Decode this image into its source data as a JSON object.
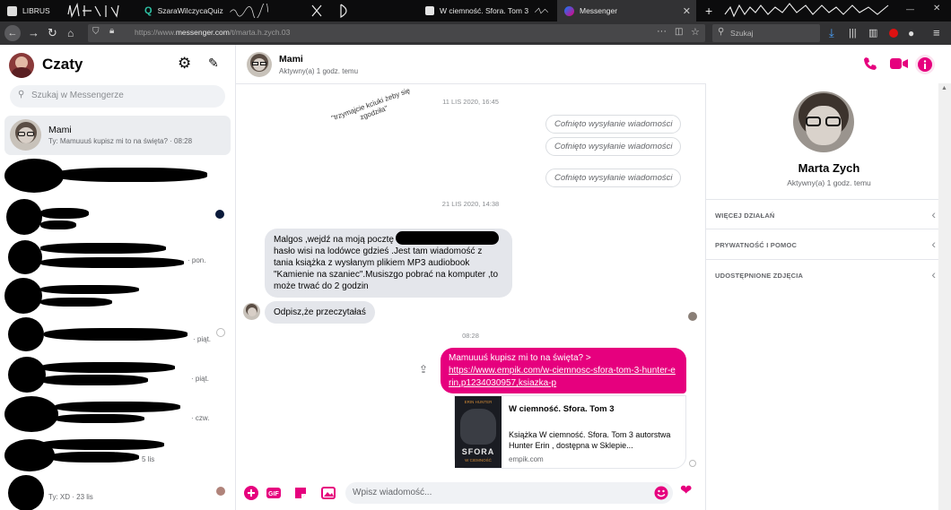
{
  "browser": {
    "tabs": [
      {
        "label": "LIBRUS"
      },
      {
        "label": ""
      },
      {
        "label": "SzaraWilczycaQuiz"
      },
      {
        "label": ""
      },
      {
        "label": "W ciemność. Sfora. Tom 3"
      },
      {
        "label": "Messenger"
      }
    ],
    "url_prefix": "https://www.",
    "url_domain": "messenger.com",
    "url_path": "/t/marta.h.zych.03",
    "search_placeholder": "Szukaj"
  },
  "sidebar": {
    "title": "Czaty",
    "search_placeholder": "Szukaj w Messengerze",
    "selected": {
      "name": "Mami",
      "preview": "Ty: Mamuuuś kupisz mi to na święta? · 08:28"
    },
    "previews": [
      {
        "text": "· pon."
      },
      {
        "text": "· piąt."
      },
      {
        "text": "· piąt."
      },
      {
        "text": "· czw."
      },
      {
        "text": "5 lis"
      },
      {
        "text": "Ty: XD · 23 lis"
      }
    ]
  },
  "conversation": {
    "name": "Mami",
    "status": "Aktywny(a) 1 godz. temu",
    "annotation": "\"trzymajcie kciuki żeby się zgodziła\"",
    "stamp1": "11 LIS 2020, 16:45",
    "unsent_label": "Cofnięto wysyłanie wiadomości",
    "stamp2": "21 LIS 2020, 14:38",
    "incoming1": "Malgos ,wejdź na moją pocztę",
    "incoming1_rest": "hasło wisi na lodówce gdzieś .Jest tam wiadomość z tania książka z wysłanym plikiem MP3  audiobook \"Kamienie na szaniec\".Musiszgo pobrać na komputer ,to może trwać do 2 godzin",
    "incoming2": "Odpisz,że przeczytałaś",
    "stamp3": "08:28",
    "outgoing_text": "Mamuuuś kupisz mi to na święta? >",
    "outgoing_link": "https://www.empik.com/w-ciemnosc-sfora-tom-3-hunter-erin,p1234030957,ksiazka-p",
    "card": {
      "title": "W ciemność. Sfora. Tom 3",
      "description": "Książka W ciemność. Sfora. Tom 3 autorstwa Hunter Erin , dostępna w Sklepie...",
      "domain": "empik.com",
      "book_author": "ERIN HUNTER",
      "book_title": "SFORA",
      "book_subtitle": "W CIEMNOŚĆ"
    },
    "composer_placeholder": "Wpisz wiadomość..."
  },
  "info_panel": {
    "name": "Marta Zych",
    "status": "Aktywny(a) 1 godz. temu",
    "sections": [
      "WIĘCEJ DZIAŁAŃ",
      "PRYWATNOŚĆ I POMOC",
      "UDOSTĘPNIONE ZDJĘCIA"
    ]
  },
  "colors": {
    "accent": "#e6007e",
    "bubble_in": "#e4e6eb",
    "chrome_dark": "#0c0c0d",
    "chrome": "#323234"
  }
}
